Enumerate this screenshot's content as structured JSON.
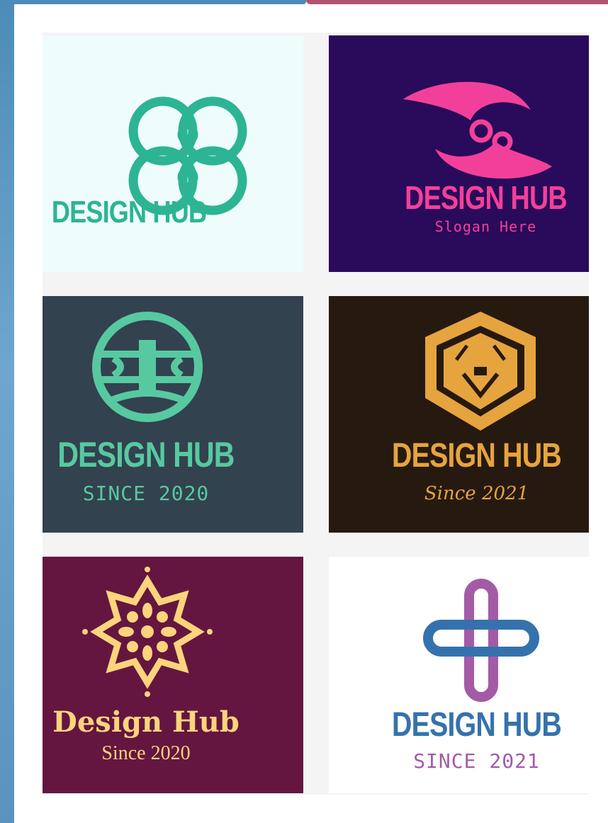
{
  "logos": [
    {
      "title": "DESIGN HUB",
      "subtitle": "",
      "bg": "#eefcfc",
      "fg": "#2db493",
      "icon": "infinity-knot-icon"
    },
    {
      "title": "DESIGN HUB",
      "subtitle": "Slogan Here",
      "bg": "#2a0a5a",
      "fg": "#f2409a",
      "icon": "swirl-icon"
    },
    {
      "title": "DESIGN HUB",
      "subtitle": "SINCE 2020",
      "bg": "#33424f",
      "fg": "#57c9a0",
      "icon": "globe-icon"
    },
    {
      "title": "DESIGN HUB",
      "subtitle": "Since 2021",
      "bg": "#261a10",
      "fg": "#e6a43e",
      "icon": "lion-hexagon-icon"
    },
    {
      "title": "Design Hub",
      "subtitle": "Since 2020",
      "bg": "#641640",
      "fg": "#fbd47c",
      "icon": "mandala-flower-icon"
    },
    {
      "title": "DESIGN HUB",
      "subtitle": "SINCE 2021",
      "bg": "#ffffff",
      "fg": "#3572ad",
      "fg2": "#a35ba6",
      "icon": "medical-cross-icon"
    }
  ]
}
